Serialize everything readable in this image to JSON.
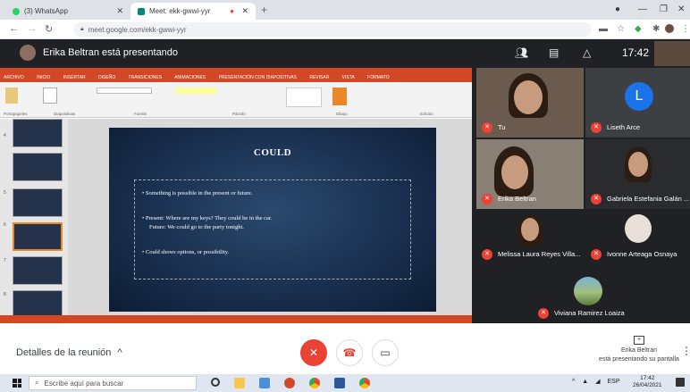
{
  "browser": {
    "tabs": [
      {
        "label": "(3) WhatsApp",
        "active": false
      },
      {
        "label": "Meet: ekk-gwwi-yyr",
        "active": true
      }
    ],
    "url": "meet.google.com/ekk-gwwi-yyr"
  },
  "meet": {
    "presenter_title": "Erika Beltran está presentando",
    "clock": "17:42",
    "meeting_details": "Detalles de la reunión",
    "presenting_name": "Erika Beltran",
    "presenting_status": "está presentando su pantalla"
  },
  "slide": {
    "title": "COULD",
    "bullets": [
      "• Something is possible in the present or future.",
      "• Present: Where are my keys? They could be in the car.",
      "Future: We could go to the party tonight.",
      "• Could shows options, or possibility."
    ]
  },
  "powerpoint": {
    "menu": [
      "ARCHIVO",
      "INICIO",
      "INSERTAR",
      "DISEÑO",
      "TRANSICIONES",
      "ANIMACIONES",
      "PRESENTACIÓN CON DIAPOSITIVAS",
      "REVISAR",
      "VISTA",
      "FORMATO"
    ],
    "groups": [
      "Portapapeles",
      "Diapositivas",
      "Fuente",
      "Párrafo",
      "Dibujo",
      "Edición"
    ],
    "thumb_numbers": [
      "4",
      "5",
      "6",
      "7",
      "8"
    ]
  },
  "participants": [
    {
      "name": "Tu",
      "initial": ""
    },
    {
      "name": "Liseth Arce",
      "initial": "L"
    },
    {
      "name": "Erika Beltran",
      "initial": ""
    },
    {
      "name": "Gabriela Estefania Galán ...",
      "initial": ""
    },
    {
      "name": "Melissa Laura Reyes Villa...",
      "initial": ""
    },
    {
      "name": "Ivonne Arteaga Osnaya",
      "initial": ""
    },
    {
      "name": "Viviana Ramirez Loaiza",
      "initial": ""
    }
  ],
  "taskbar": {
    "search_placeholder": "Escribe aquí para buscar",
    "lang": "ESP",
    "time": "17:42",
    "date": "26/04/2021"
  },
  "colors": {
    "meet_bg": "#202124",
    "mic_off": "#ea4335",
    "ppt_accent": "#d24726",
    "avatar_L": "#1a73e8"
  },
  "icons": [
    "back-icon",
    "forward-icon",
    "reload-icon",
    "lock-icon",
    "star-icon",
    "mic-off-icon",
    "hangup-icon",
    "present-icon",
    "more-vert-icon",
    "search-icon",
    "windows-logo-icon",
    "people-icon",
    "chat-icon",
    "activities-icon"
  ]
}
